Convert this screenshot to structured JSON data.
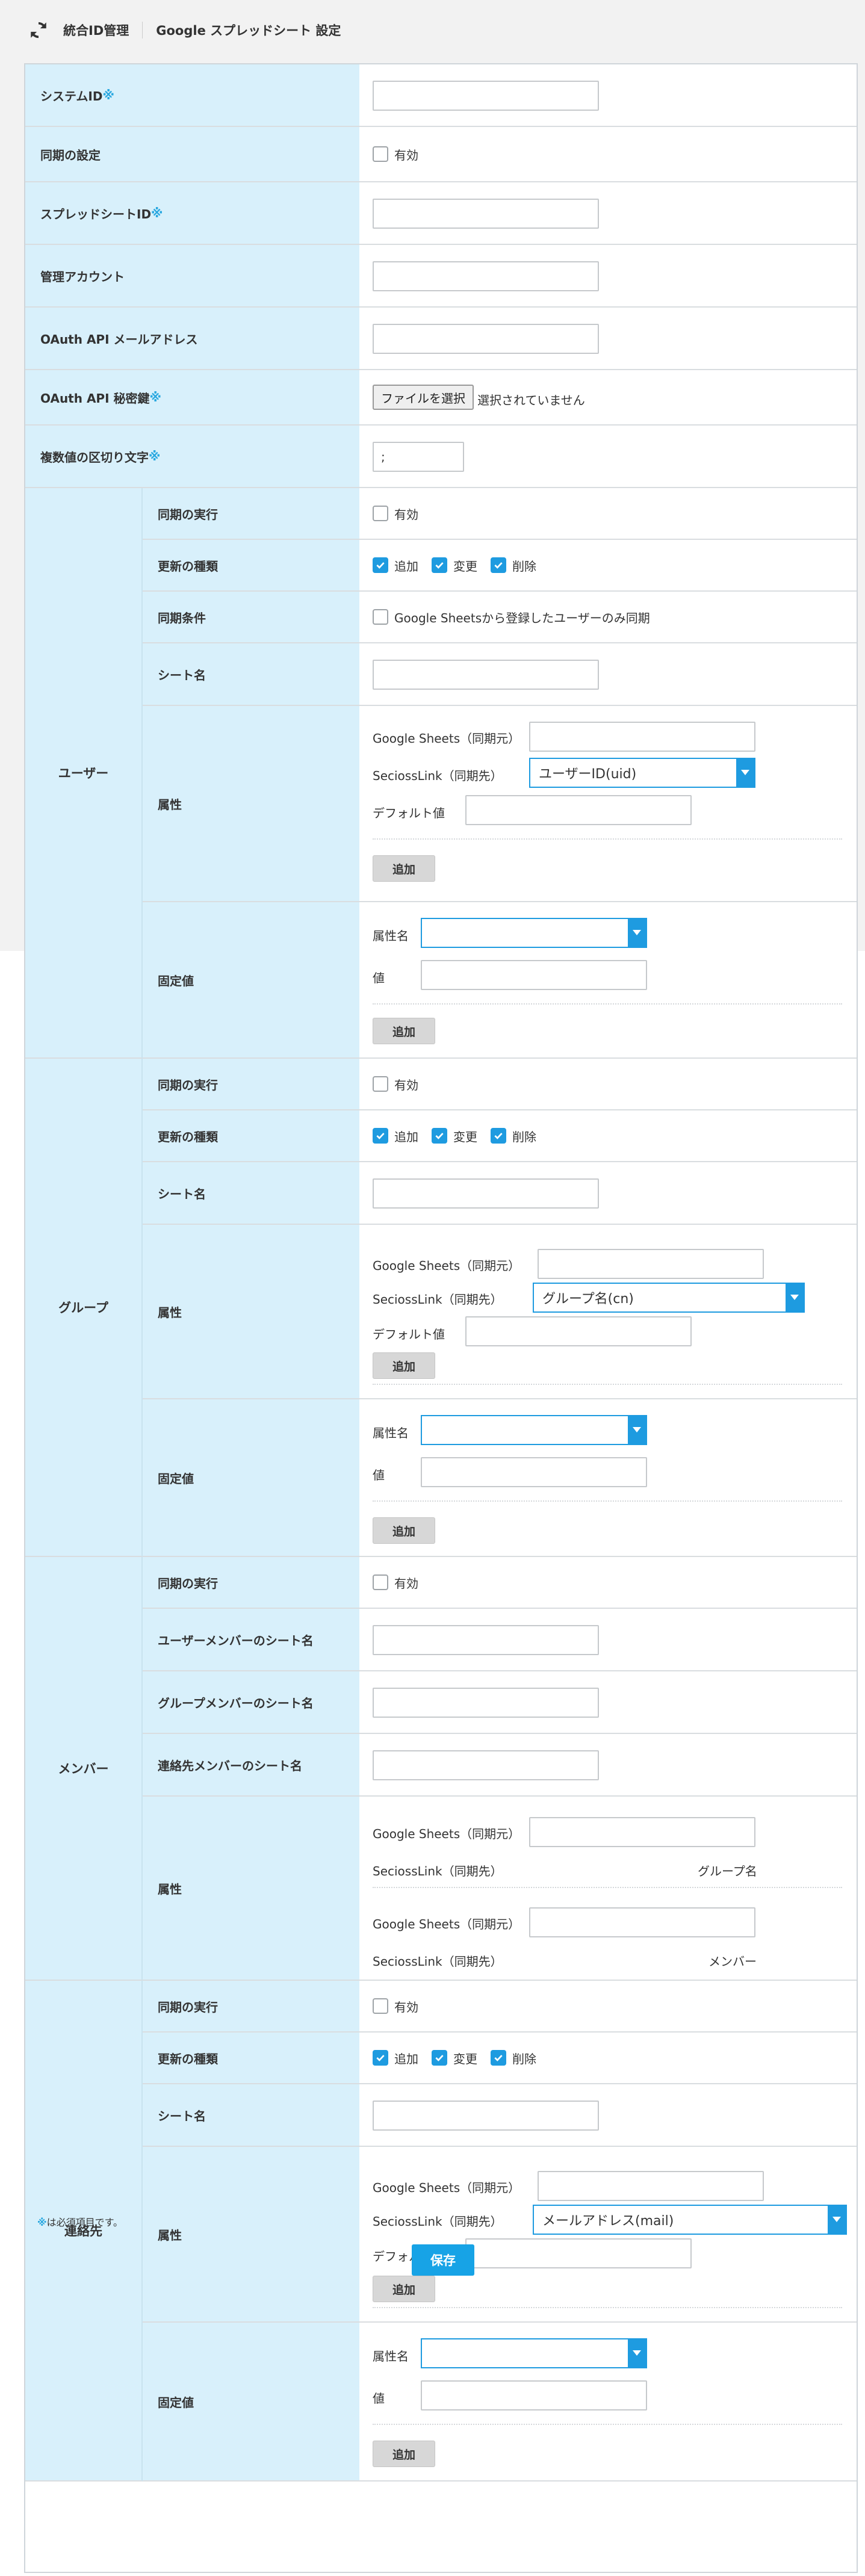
{
  "header": {
    "logo_icon": "sync-icon",
    "crumb1": "統合ID管理",
    "crumb2": "Google スプレッドシート 設定"
  },
  "required_mark": "※",
  "general": {
    "system_id": "システムID",
    "sync_setting": "同期の設定",
    "enabled": "有効",
    "spreadsheet_id": "スプレッドシートID",
    "admin_account": "管理アカウント",
    "oauth_email": "OAuth API メールアドレス",
    "oauth_secret": "OAuth API 秘密鍵",
    "file_button": "ファイルを選択",
    "file_status": "選択されていません",
    "delimiter": "複数値の区切り文字",
    "delimiter_value": ";"
  },
  "common": {
    "run_sync": "同期の実行",
    "update_type": "更新の種類",
    "add": "追加",
    "change": "変更",
    "delete": "削除",
    "sheet_name": "シート名",
    "attributes": "属性",
    "fixed_value": "固定値",
    "gs_source": "Google Sheets（同期元）",
    "sl_target": "SeciossLink（同期先）",
    "default_value": "デフォルト値",
    "add_button": "追加",
    "attr_name": "属性名",
    "value": "値"
  },
  "user": {
    "title": "ユーザー",
    "sync_condition": "同期条件",
    "sync_condition_text": "Google Sheetsから登録したユーザーのみ同期",
    "attr_select": "ユーザーID(uid)"
  },
  "group": {
    "title": "グループ",
    "attr_select": "グループ名(cn)"
  },
  "member": {
    "title": "メンバー",
    "user_member_sheet": "ユーザーメンバーのシート名",
    "group_member_sheet": "グループメンバーのシート名",
    "contact_member_sheet": "連絡先メンバーのシート名",
    "target1": "グループ名",
    "target2": "メンバー"
  },
  "contact": {
    "title": "連絡先",
    "attr_select": "メールアドレス(mail)"
  },
  "footer": {
    "note": "は必須項目です。",
    "save": "保存"
  }
}
